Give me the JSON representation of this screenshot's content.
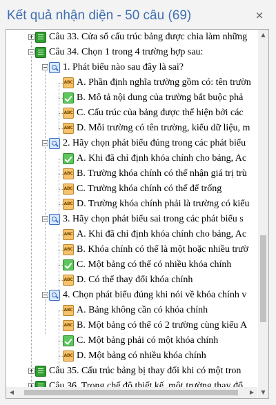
{
  "pane": {
    "title": "Kết quả nhận diện - 50 câu (69)",
    "close_glyph": "×"
  },
  "tree": {
    "rows": [
      {
        "label": "Câu 33. Cửa sổ cấu trúc bảng được chia làm những",
        "icon": "list-icon",
        "expander": "plus"
      },
      {
        "label": "Câu 34. Chọn 1 trong 4 trường hợp sau:",
        "icon": "list-icon",
        "expander": "minus"
      },
      {
        "label": "1. Phát biểu nào sau đây là sai?",
        "icon": "question-icon",
        "expander": "minus"
      },
      {
        "label": "A. Phần định nghĩa trường gồm có: tên trườn",
        "icon": "abc-icon"
      },
      {
        "label": "B. Mô tả nội dung của trường bắt buộc phả",
        "icon": "check-icon"
      },
      {
        "label": "C. Cấu trúc của bảng được thể hiện bởi các",
        "icon": "abc-icon"
      },
      {
        "label": "D. Mỗi trường có tên trường, kiểu dữ liệu, m",
        "icon": "abc-icon"
      },
      {
        "label": "2. Hãy chọn phát biểu đúng trong các phát biểu",
        "icon": "question-icon",
        "expander": "minus"
      },
      {
        "label": "A. Khi đã chỉ định khóa chính cho bảng, Ac",
        "icon": "check-icon"
      },
      {
        "label": "B. Trường khóa chính có thể nhận giá trị  trù",
        "icon": "abc-icon"
      },
      {
        "label": "C. Trường khóa chính có thể để trống",
        "icon": "abc-icon"
      },
      {
        "label": "D. Trường khóa chính phải là trường có kiểu",
        "icon": "abc-icon"
      },
      {
        "label": "3. Hãy chọn phát biểu sai  trong các phát biểu s",
        "icon": "question-icon",
        "expander": "minus"
      },
      {
        "label": "A. Khi đã chỉ định khóa chính cho bảng, Ac",
        "icon": "abc-icon"
      },
      {
        "label": "B. Khóa chính có thể là một hoặc nhiều trườ",
        "icon": "abc-icon"
      },
      {
        "label": "C. Một bảng có thể có nhiều khóa chính",
        "icon": "check-icon"
      },
      {
        "label": "D. Có thể thay đổi khóa chính",
        "icon": "abc-icon"
      },
      {
        "label": "4. Chọn phát biểu đúng khi nói về khóa chính v",
        "icon": "question-icon",
        "expander": "minus"
      },
      {
        "label": "A. Bảng không cần có khóa chính",
        "icon": "abc-icon"
      },
      {
        "label": "B. Một bảng có thể có 2 trường cùng kiểu A",
        "icon": "abc-icon"
      },
      {
        "label": "C. Một bảng phải có một khóa chính",
        "icon": "check-icon"
      },
      {
        "label": "D. Một bảng có nhiều khóa chính",
        "icon": "abc-icon"
      },
      {
        "label": "Câu 35. Cấu trúc bảng bị thay đổi khi có một tron",
        "icon": "list-icon",
        "expander": "plus"
      },
      {
        "label": "Câu 36. Trong chế độ thiết kế, một trường thay đổ",
        "icon": "list-icon",
        "expander": "plus"
      }
    ],
    "abc_text": "ABC"
  },
  "scrollbars": {
    "up": "▲",
    "down": "▼",
    "left": "◀",
    "right": "▶"
  },
  "colors": {
    "title": "#3f6fb3",
    "list_icon": "#2f9e2f",
    "question_icon": "#3a6fc4",
    "answer_icon": "#f6c26b",
    "correct_icon": "#5cc75c"
  }
}
